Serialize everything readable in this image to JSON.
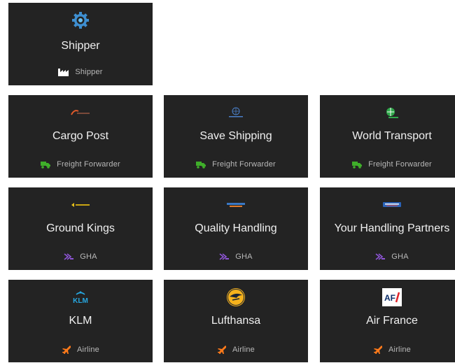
{
  "colors": {
    "card_bg": "#232323",
    "freight": "#3fae2a",
    "gha": "#8e55d6",
    "airline": "#ff7a1a",
    "shipper_icon": "#5aa9e6"
  },
  "cards": [
    {
      "name": "Shipper",
      "role": "Shipper",
      "role_icon": "factory-icon",
      "logo": "gear-icon"
    },
    {
      "name": "Cargo Post",
      "role": "Freight Forwarder",
      "role_icon": "truck-icon",
      "logo": "cargo-post-logo"
    },
    {
      "name": "Save Shipping",
      "role": "Freight Forwarder",
      "role_icon": "truck-icon",
      "logo": "save-shipping-logo"
    },
    {
      "name": "World Transport",
      "role": "Freight Forwarder",
      "role_icon": "truck-icon",
      "logo": "world-transport-logo"
    },
    {
      "name": "Ground Kings",
      "role": "GHA",
      "role_icon": "handling-icon",
      "logo": "ground-kings-logo"
    },
    {
      "name": "Quality Handling",
      "role": "GHA",
      "role_icon": "handling-icon",
      "logo": "quality-handling-logo"
    },
    {
      "name": "Your Handling Partners",
      "role": "GHA",
      "role_icon": "handling-icon",
      "logo": "your-handling-partners-logo"
    },
    {
      "name": "KLM",
      "role": "Airline",
      "role_icon": "airplane-icon",
      "logo": "klm-logo"
    },
    {
      "name": "Lufthansa",
      "role": "Airline",
      "role_icon": "airplane-icon",
      "logo": "lufthansa-logo"
    },
    {
      "name": "Air France",
      "role": "Airline",
      "role_icon": "airplane-icon",
      "logo": "air-france-logo"
    }
  ]
}
